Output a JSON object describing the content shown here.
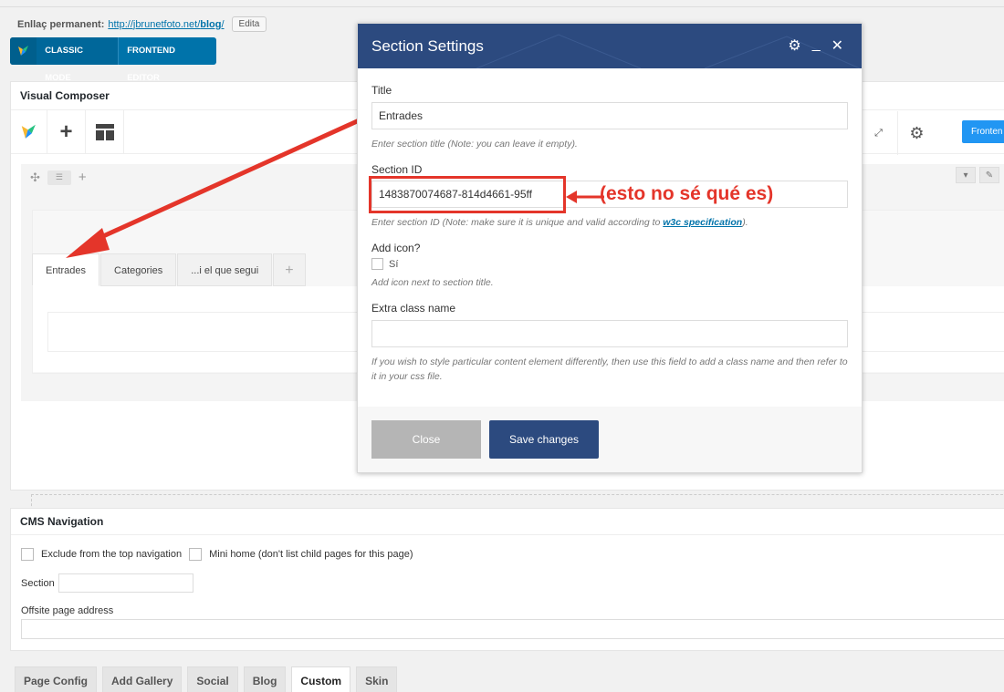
{
  "permalink": {
    "label": "Enllaç permanent:",
    "url_base": "http://jbrunetfoto.net/",
    "url_slug": "blog",
    "url_trail": "/",
    "edit_label": "Edita"
  },
  "mode_bar": {
    "classic_label": "CLASSIC MODE",
    "frontend_label": "FRONTEND EDITOR"
  },
  "visual_composer": {
    "title": "Visual Composer",
    "frontend_button": "Fronten",
    "tabs": [
      "Entrades",
      "Categories",
      "...i el que segui"
    ]
  },
  "modal": {
    "title": "Section Settings",
    "title_label": "Title",
    "title_value": "Entrades",
    "title_hint": "Enter section title (Note: you can leave it empty).",
    "section_id_label": "Section ID",
    "section_id_value": "1483870074687-814d4661-95ff",
    "section_id_hint_pre": "Enter section ID (Note: make sure it is unique and valid according to ",
    "section_id_hint_link": "w3c specification",
    "section_id_hint_post": ").",
    "add_icon_label": "Add icon?",
    "add_icon_option": "Sí",
    "add_icon_hint": "Add icon next to section title.",
    "extra_class_label": "Extra class name",
    "extra_class_value": "",
    "extra_class_hint": "If you wish to style particular content element differently, then use this field to add a class name and then refer to it in your css file.",
    "close_label": "Close",
    "save_label": "Save changes"
  },
  "annotation": {
    "text": "(esto no sé qué es)",
    "color": "#e4352a"
  },
  "cms_navigation": {
    "title": "CMS Navigation",
    "exclude_label": "Exclude from the top navigation",
    "mini_home_label": "Mini home (don't list child pages for this page)",
    "section_label": "Section",
    "offsite_label": "Offsite page address"
  },
  "bottom_tabs": [
    {
      "label": "Page Config",
      "active": false
    },
    {
      "label": "Add Gallery",
      "active": false
    },
    {
      "label": "Social",
      "active": false
    },
    {
      "label": "Blog",
      "active": false
    },
    {
      "label": "Custom",
      "active": true
    },
    {
      "label": "Skin",
      "active": false
    }
  ],
  "colors": {
    "modal_header": "#2c4a7f",
    "primary_blue": "#0073aa",
    "frontend_blue": "#2196f3",
    "annotation_red": "#e4352a"
  }
}
